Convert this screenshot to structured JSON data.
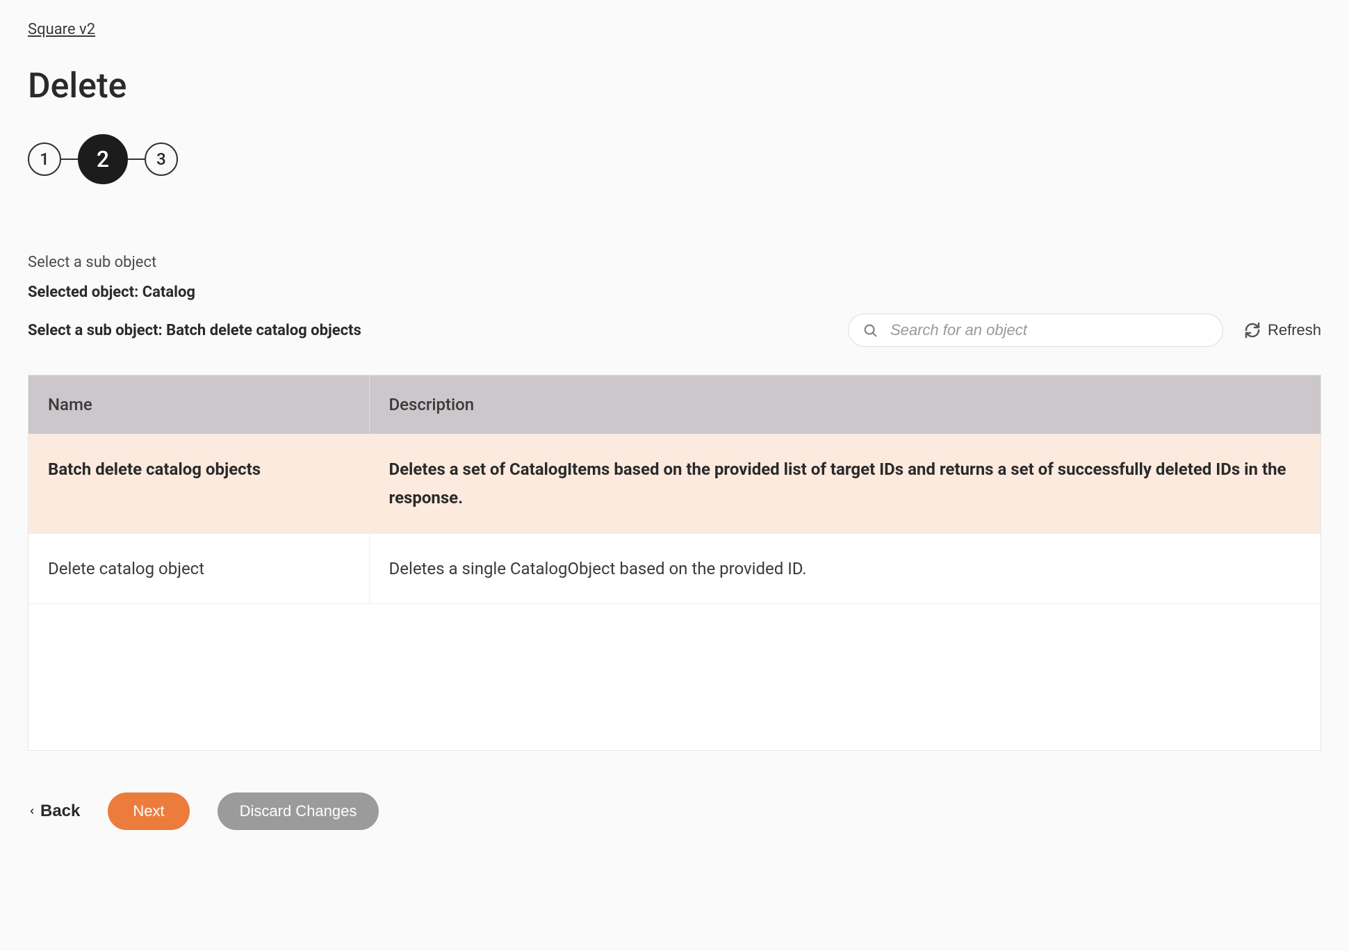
{
  "breadcrumb": "Square v2",
  "page_title": "Delete",
  "stepper": {
    "steps": [
      "1",
      "2",
      "3"
    ],
    "active_index": 1
  },
  "labels": {
    "select_sub": "Select a sub object",
    "selected_object": "Selected object: Catalog",
    "select_sub_value": "Select a sub object: Batch delete catalog objects"
  },
  "search": {
    "placeholder": "Search for an object",
    "value": ""
  },
  "refresh_label": "Refresh",
  "table": {
    "headers": {
      "name": "Name",
      "description": "Description"
    },
    "rows": [
      {
        "name": "Batch delete catalog objects",
        "description": "Deletes a set of CatalogItems based on the provided list of target IDs and returns a set of successfully deleted IDs in the response.",
        "selected": true
      },
      {
        "name": "Delete catalog object",
        "description": "Deletes a single CatalogObject based on the provided ID.",
        "selected": false
      }
    ]
  },
  "buttons": {
    "back": "Back",
    "next": "Next",
    "discard": "Discard Changes"
  }
}
